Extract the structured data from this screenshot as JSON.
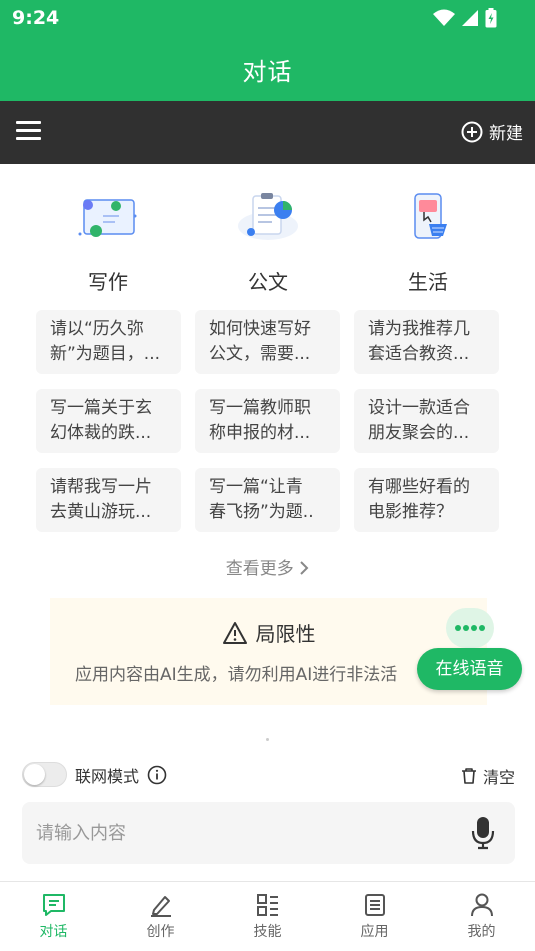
{
  "status_bar": {
    "time": "9:24"
  },
  "header": {
    "title": "对话"
  },
  "toolbar": {
    "new_label": "新建"
  },
  "categories": [
    {
      "label": "写作",
      "icon": "writing-icon"
    },
    {
      "label": "公文",
      "icon": "document-icon"
    },
    {
      "label": "生活",
      "icon": "shopping-icon"
    }
  ],
  "prompts": [
    [
      "请以“历久弥",
      "新”为题目，..."
    ],
    [
      "如何快速写好",
      "公文，需要..."
    ],
    [
      "请为我推荐几",
      "套适合教资..."
    ],
    [
      "写一篇关于玄",
      "幻体裁的跌..."
    ],
    [
      "写一篇教师职",
      "称申报的材..."
    ],
    [
      "设计一款适合",
      "朋友聚会的..."
    ],
    [
      "请帮我写一片",
      "去黄山游玩..."
    ],
    [
      "写一篇“让青",
      "春飞扬”为题.."
    ],
    [
      "有哪些好看的",
      "电影推荐？"
    ]
  ],
  "see_more": "查看更多",
  "limitation": {
    "title": "局限性",
    "text": "应用内容由AI生成，请勿利用AI进行非法活"
  },
  "voice": {
    "label": "在线语音"
  },
  "network": {
    "label": "联网模式",
    "enabled": false
  },
  "clear": {
    "label": "清空"
  },
  "input": {
    "placeholder": "请输入内容"
  },
  "bottom_nav": [
    {
      "label": "对话",
      "active": true
    },
    {
      "label": "创作",
      "active": false
    },
    {
      "label": "技能",
      "active": false
    },
    {
      "label": "应用",
      "active": false
    },
    {
      "label": "我的",
      "active": false
    }
  ],
  "colors": {
    "brand": "#1fb865",
    "toolbar": "#303030",
    "card": "#fffaee"
  }
}
